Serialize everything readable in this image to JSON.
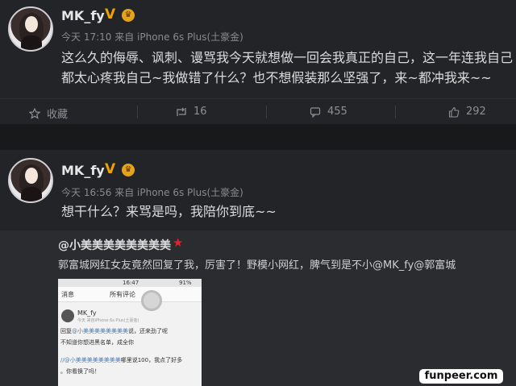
{
  "post1": {
    "username": "MK_fy",
    "verified_badge": "V",
    "meta": "今天 17:10 来自 iPhone 6s Plus(土豪金)",
    "text_line1": "这么久的侮辱、讽刺、谩骂我今天就想做一回会我真正的自己，这一年连我自己",
    "text_line2": "都太心疼我自己~我做错了什么？也不想假装那么坚强了，来~都冲我来~~",
    "actions": {
      "favorite_label": "收藏",
      "repost_count": "16",
      "comment_count": "455",
      "like_count": "292"
    }
  },
  "post2": {
    "username": "MK_fy",
    "verified_badge": "V",
    "meta": "今天 16:56 来自 iPhone 6s Plus(土豪金)",
    "text": "想干什么？来骂是吗，我陪你到底~~",
    "repost": {
      "original_user": "@小美美美美美美美美",
      "original_text": "郭富城网红女友竟然回复了我，厉害了！野模小网红，脾气到是不小@MK_fy@郭富城",
      "thumbnail": {
        "status_time": "16:47",
        "status_battery": "91%",
        "back_label": "消息",
        "title": "所有评论",
        "user": "MK_fy",
        "meta": "今天 来自iPhone 6s Plus(土豪金)",
        "line1_prefix": "回复",
        "line1_mention": "@小美美美美美美美美",
        "line1_text": "说，还来劲了呢",
        "line2": "不知道你想进黑名单，成全你",
        "line3_mention": "//@小美美美美美美美美",
        "line3_text": "哪里说100，我点了好多",
        "line4": "。你看换了吗！"
      }
    }
  },
  "watermark": "funpeer.com",
  "colors": {
    "background": "#232428",
    "separator": "#18191b",
    "repost_bg": "#2b2c30",
    "verified": "#f2a200",
    "star": "#e0242b"
  },
  "icons": [
    "favorite-icon",
    "repost-icon",
    "comment-icon",
    "like-icon",
    "crown-icon",
    "star-icon"
  ]
}
